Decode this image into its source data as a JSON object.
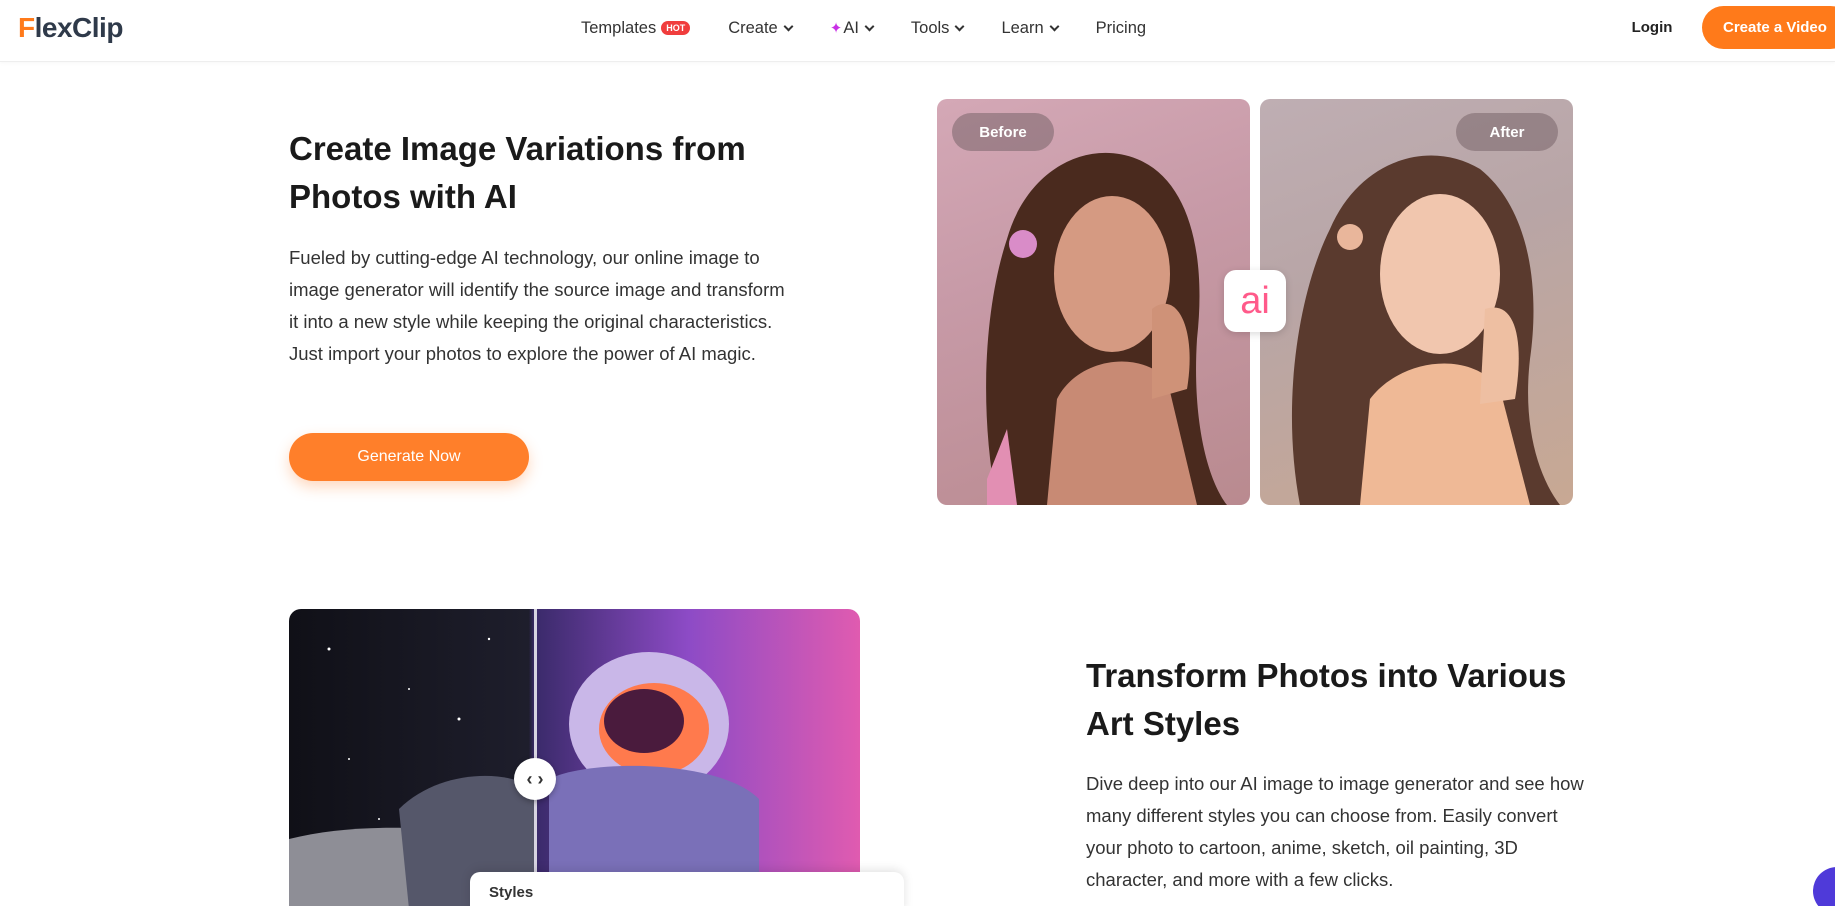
{
  "header": {
    "logo": "FlexClip",
    "nav": [
      {
        "label": "Templates",
        "badge": "HOT",
        "dropdown": false
      },
      {
        "label": "Create",
        "dropdown": true
      },
      {
        "label": "AI",
        "dropdown": true,
        "icon": "sparkle-icon"
      },
      {
        "label": "Tools",
        "dropdown": true
      },
      {
        "label": "Learn",
        "dropdown": true
      },
      {
        "label": "Pricing",
        "dropdown": false
      }
    ],
    "login_label": "Login",
    "cta_label": "Create a Video"
  },
  "section1": {
    "title": "Create Image Variations from Photos with AI",
    "body": "Fueled by cutting-edge AI technology, our online image to image generator will identify the source image and transform it into a new style while keeping the original characteristics. Just import your photos to explore the power of AI magic.",
    "button_label": "Generate Now",
    "before_label": "Before",
    "after_label": "After",
    "ai_badge": "ai"
  },
  "section2": {
    "title": "Transform Photos into Various Art Styles",
    "body": "Dive deep into our AI image to image generator and see how many different styles you can choose from. Easily convert your photo to cartoon, anime, sketch, oil painting, 3D character, and more with a few clicks.",
    "styles_label": "Styles",
    "slider_handle": "‹ ›"
  },
  "colors": {
    "brand_orange": "#ff7a1a",
    "hot_badge": "#f03d3d",
    "ai_pink": "#ff5a8a",
    "chat_purple": "#4f3ad9"
  }
}
